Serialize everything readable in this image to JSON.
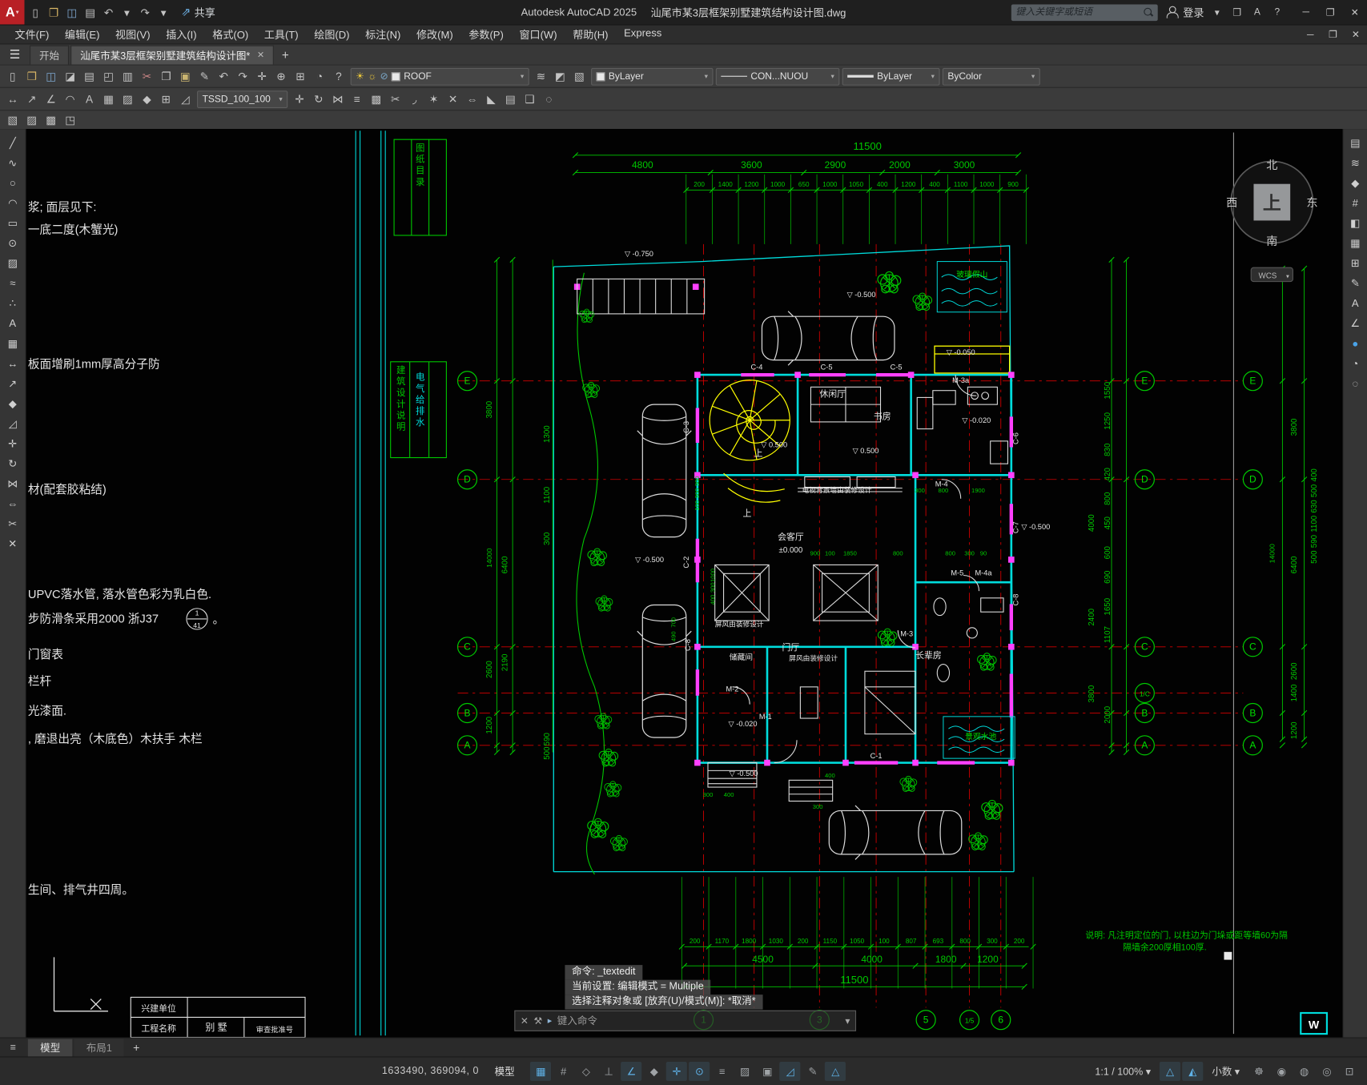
{
  "titlebar": {
    "logo_letter": "A",
    "quick_access": [
      {
        "name": "new-drawing-icon",
        "glyph": "▯"
      },
      {
        "name": "open-icon",
        "glyph": "❒",
        "color": "#d8b565"
      },
      {
        "name": "save-icon",
        "glyph": "◫",
        "color": "#7fa8d0"
      },
      {
        "name": "plot-icon",
        "glyph": "▤"
      },
      {
        "name": "undo-icon",
        "glyph": "↶"
      },
      {
        "name": "undo-caret-icon",
        "glyph": "▾"
      },
      {
        "name": "redo-icon",
        "glyph": "↷"
      },
      {
        "name": "redo-caret-icon",
        "glyph": "▾"
      }
    ],
    "share_label": "共享",
    "app_title": "Autodesk AutoCAD 2025",
    "doc_title": "汕尾市某3层框架别墅建筑结构设计图.dwg",
    "search_placeholder": "键入关键字或短语",
    "signin_label": "登录",
    "account_caret": "▾",
    "store_glyph": "❒",
    "assistant_glyph": "A",
    "help_glyph": "?"
  },
  "window_controls": {
    "minimize": "─",
    "restore": "❐",
    "close": "✕"
  },
  "menubar": {
    "items": [
      "文件(F)",
      "编辑(E)",
      "视图(V)",
      "插入(I)",
      "格式(O)",
      "工具(T)",
      "绘图(D)",
      "标注(N)",
      "修改(M)",
      "参数(P)",
      "窗口(W)",
      "帮助(H)",
      "Express"
    ]
  },
  "doc_tabs": {
    "start_tab": "开始",
    "drawing_tab": "汕尾市某3层框架别墅建筑结构设计图*",
    "close_glyph": "✕",
    "new_tab_button": "+",
    "hamburger_glyph": "☰"
  },
  "toolbar1": {
    "left_icons": [
      {
        "name": "qnew-icon",
        "glyph": "▯"
      },
      {
        "name": "open-icon",
        "glyph": "❒",
        "color": "#d8b565"
      },
      {
        "name": "save-icon",
        "glyph": "◫",
        "color": "#7fa8d0"
      },
      {
        "name": "save-as-icon",
        "glyph": "◪"
      },
      {
        "name": "plot-icon",
        "glyph": "▤"
      },
      {
        "name": "plot-preview-icon",
        "glyph": "◰"
      },
      {
        "name": "publish-icon",
        "glyph": "▥"
      },
      {
        "name": "cut-icon",
        "glyph": "✂",
        "color": "#c98585"
      },
      {
        "name": "copy-icon",
        "glyph": "❐"
      },
      {
        "name": "paste-icon",
        "glyph": "▣",
        "color": "#c9b470"
      },
      {
        "name": "match-properties-icon",
        "glyph": "✎"
      },
      {
        "name": "undo-icon",
        "glyph": "↶"
      },
      {
        "name": "redo-icon",
        "glyph": "↷"
      },
      {
        "name": "pan-icon",
        "glyph": "✛"
      },
      {
        "name": "zoom-realtime-icon",
        "glyph": "⊕"
      },
      {
        "name": "zoom-window-icon",
        "glyph": "⊞"
      },
      {
        "name": "orbit-icon",
        "glyph": "◔"
      },
      {
        "name": "help-icon",
        "glyph": "?"
      }
    ],
    "layer_combo": {
      "value": "ROOF",
      "on_glyph": "☀",
      "freeze_glyph": "☼",
      "lock_glyph": "⊘"
    },
    "mid_icons": [
      {
        "name": "layer-states-icon",
        "glyph": "≋"
      },
      {
        "name": "layer-isolate-icon",
        "glyph": "◩"
      },
      {
        "name": "layer-walk-icon",
        "glyph": "▧"
      }
    ],
    "color_combo": {
      "value": "ByLayer"
    },
    "linetype_combo": {
      "value": "CON...NUOU"
    },
    "lineweight_combo": {
      "value": "ByLayer"
    },
    "plotstyle_combo": {
      "value": "ByColor"
    }
  },
  "toolbar2": {
    "left_icons": [
      {
        "name": "dim-linear-icon",
        "glyph": "↔"
      },
      {
        "name": "dim-aligned-icon",
        "glyph": "↗"
      },
      {
        "name": "dim-angular-icon",
        "glyph": "∠"
      },
      {
        "name": "dim-radius-icon",
        "glyph": "◠"
      },
      {
        "name": "mtext-icon",
        "glyph": "A"
      },
      {
        "name": "table-icon",
        "glyph": "▦"
      },
      {
        "name": "hatch-icon",
        "glyph": "▨"
      },
      {
        "name": "block-icon",
        "glyph": "◆"
      },
      {
        "name": "insert-icon",
        "glyph": "⊞"
      },
      {
        "name": "measure-icon",
        "glyph": "◿"
      }
    ],
    "style_combo": {
      "value": "TSSD_100_100"
    },
    "right_icons": [
      {
        "name": "move-icon",
        "glyph": "✛"
      },
      {
        "name": "rotate-icon",
        "glyph": "↻"
      },
      {
        "name": "mirror-icon",
        "glyph": "⋈"
      },
      {
        "name": "offset-icon",
        "glyph": "≡"
      },
      {
        "name": "array-icon",
        "glyph": "▩"
      },
      {
        "name": "trim-icon",
        "glyph": "✂"
      },
      {
        "name": "fillet-icon",
        "glyph": "◞"
      },
      {
        "name": "explode-icon",
        "glyph": "✶"
      },
      {
        "name": "erase-icon",
        "glyph": "✕"
      },
      {
        "name": "stretch-icon",
        "glyph": "⇔"
      },
      {
        "name": "scale-icon",
        "glyph": "◣"
      },
      {
        "name": "properties-icon",
        "glyph": "▤"
      },
      {
        "name": "group-icon",
        "glyph": "❑"
      },
      {
        "name": "selection-icon",
        "glyph": "◌"
      }
    ]
  },
  "toolbar3": {
    "icons": [
      {
        "name": "edit-reference-icon",
        "glyph": "▧"
      },
      {
        "name": "image-attach-icon",
        "glyph": "▨"
      },
      {
        "name": "clip-xref-icon",
        "glyph": "▩"
      },
      {
        "name": "frame-icon",
        "glyph": "◳"
      }
    ]
  },
  "left_toolbar": {
    "icons": [
      {
        "name": "line-tool-icon",
        "glyph": "╱"
      },
      {
        "name": "polyline-tool-icon",
        "glyph": "∿"
      },
      {
        "name": "circle-tool-icon",
        "glyph": "○"
      },
      {
        "name": "arc-tool-icon",
        "glyph": "◠"
      },
      {
        "name": "rectangle-tool-icon",
        "glyph": "▭"
      },
      {
        "name": "ellipse-tool-icon",
        "glyph": "⊙"
      },
      {
        "name": "hatch-tool-icon",
        "glyph": "▨"
      },
      {
        "name": "spline-tool-icon",
        "glyph": "≈"
      },
      {
        "name": "point-tool-icon",
        "glyph": "∴"
      },
      {
        "name": "text-tool-icon",
        "glyph": "A"
      },
      {
        "name": "table-tool-icon",
        "glyph": "▦"
      },
      {
        "name": "dimension-tool-icon",
        "glyph": "↔"
      },
      {
        "name": "leader-tool-icon",
        "glyph": "↗"
      },
      {
        "name": "block-tool-icon",
        "glyph": "◆"
      },
      {
        "name": "measure-tool-icon",
        "glyph": "◿"
      },
      {
        "name": "move-tool-icon",
        "glyph": "✛"
      },
      {
        "name": "rotate-tool-icon",
        "glyph": "↻"
      },
      {
        "name": "mirror-tool-icon",
        "glyph": "⋈"
      },
      {
        "name": "stretch-tool-icon",
        "glyph": "⇔"
      },
      {
        "name": "trim-tool-icon",
        "glyph": "✂"
      },
      {
        "name": "erase-tool-icon",
        "glyph": "✕"
      }
    ]
  },
  "right_toolbar": {
    "icons": [
      {
        "name": "properties-panel-icon",
        "glyph": "▤"
      },
      {
        "name": "layers-panel-icon",
        "glyph": "≋"
      },
      {
        "name": "blocks-panel-icon",
        "glyph": "◆"
      },
      {
        "name": "count-panel-icon",
        "glyph": "#"
      },
      {
        "name": "views-panel-icon",
        "glyph": "◧"
      },
      {
        "name": "sheet-set-panel-icon",
        "glyph": "▦"
      },
      {
        "name": "xref-panel-icon",
        "glyph": "⊞"
      },
      {
        "name": "markup-panel-icon",
        "glyph": "✎"
      },
      {
        "name": "text-panel-icon",
        "glyph": "A"
      },
      {
        "name": "measure-panel-icon",
        "glyph": "∠"
      },
      {
        "name": "render-panel-icon",
        "glyph": "●",
        "color": "#4aa3e8"
      },
      {
        "name": "visual-style-icon",
        "glyph": "◔"
      },
      {
        "name": "cursor-badge-icon",
        "glyph": "◌"
      }
    ]
  },
  "compass": {
    "north": "北",
    "south": "南",
    "east": "东",
    "west": "西",
    "top": "上",
    "wcs": "WCS"
  },
  "drawing": {
    "top_dims": {
      "total": "11500",
      "segments": [
        "4800",
        "3600",
        "2900",
        "2000",
        "3000"
      ],
      "minor": [
        "200",
        "1400",
        "1200",
        "1000",
        "650",
        "1000",
        "1050",
        "400",
        "1200",
        "400",
        "1100",
        "1000",
        "900"
      ]
    },
    "bottom_dims": {
      "total": "11500",
      "segments": [
        "4500",
        "4000",
        "1800",
        "1200"
      ],
      "minor": [
        "200",
        "1170",
        "1800",
        "1030",
        "200",
        "1150",
        "1050",
        "100",
        "807",
        "693",
        "800",
        "300",
        "200"
      ]
    },
    "left_axes": [
      "E",
      "D",
      "C",
      "B",
      "A"
    ],
    "right_axes": [
      "E",
      "D",
      "C",
      "1/C",
      "B",
      "A"
    ],
    "far_right_axes": [
      "E",
      "D",
      "C",
      "B",
      "A"
    ],
    "bottom_axes": [
      "1",
      "3",
      "5",
      "1/5",
      "6"
    ],
    "left_dims_a": [
      "3800",
      "14000",
      "2600",
      "1200"
    ],
    "left_dims_b": [
      "6400",
      "2190"
    ],
    "left_dims_minor": [
      "1300",
      "1100",
      "300",
      "590",
      "500"
    ],
    "right_dims_a": [
      "1550",
      "1250",
      "830",
      "420",
      "800",
      "450",
      "600",
      "690",
      "1650",
      "1107",
      "2000"
    ],
    "right_dims_b": [
      "4000",
      "2400",
      "3800"
    ],
    "far_right_dims_a": [
      "3800",
      "6400",
      "2600",
      "1400",
      "1200"
    ],
    "far_right_dims_b": [
      "14000"
    ],
    "far_right_dims_minor": [
      "400",
      "500",
      "630",
      "1100",
      "590",
      "500"
    ],
    "interior_dims": [
      "300",
      "300",
      "100",
      "1000",
      "300",
      "400",
      "700",
      "490",
      "900",
      "100",
      "1850",
      "800",
      "800",
      "300",
      "90",
      "300",
      "800",
      "1900",
      "300",
      "400",
      "400",
      "300"
    ],
    "rooms": {
      "leisure": "休闲厅",
      "study": "书房",
      "living": "会客厅",
      "living_elev": "±0.000",
      "tv_note": "电视背景墙由装修设计",
      "screen_note": "屏风由装修设计",
      "screen_note2": "屏风由装修设计",
      "hall": "门厅",
      "storage": "储藏间",
      "elder": "长辈房",
      "rock": "玻璃假山",
      "pond": "景观水池",
      "up1": "上",
      "up2": "上"
    },
    "elevations": [
      "-0.750",
      "-0.500",
      "-0.050",
      "-0.020",
      "0.500",
      "0.500",
      "-0.500",
      "-0.020",
      "-0.500",
      "-0.500"
    ],
    "tags": [
      "C-4",
      "C-5",
      "C-5",
      "M-3a",
      "C-3",
      "C-6",
      "M-4",
      "C-2",
      "C-7",
      "M-5",
      "M-4a",
      "C-8",
      "M-3",
      "C-8",
      "M-2",
      "M-1",
      "C-1"
    ],
    "notes_left": [
      "浆; 面层见下:",
      "一底二度(木蟹光)",
      "板面增刷1mm厚高分子防",
      "材(配套胶粘结)",
      "UPVC落水管, 落水管色彩为乳白色.",
      "步防滑条采用2000 浙J37",
      "门窗表",
      "栏杆",
      "光漆面.",
      ", 磨退出亮（木底色）木扶手  木栏",
      "生间、排气井四周。"
    ],
    "detail_ref": {
      "top": "1",
      "bottom": "41",
      "suffix": "。"
    },
    "strip_labels": [
      "图纸目录",
      "建筑设计说明",
      "电气给排水"
    ],
    "note_right_1": "说明: 凡注明定位的门, 以柱边为门垛或距等墙60为隔",
    "note_right_2": "隔墙余200厚相100厚.",
    "title_block": {
      "row1": "兴建单位",
      "row2": "工程名称",
      "project": "别 墅",
      "approval": "审查批准号"
    },
    "corner_badge": "W"
  },
  "command": {
    "line1": "命令: _textedit",
    "line2": "当前设置: 编辑模式 = Multiple",
    "line3": "选择注释对象或 [放弃(U)/模式(M)]: *取消*",
    "input_placeholder": "键入命令",
    "close_glyph": "✕",
    "customize_glyph": "⚒",
    "history_glyph": "▾"
  },
  "layout_tabs": {
    "menu_glyph": "≡",
    "model": "模型",
    "layout1": "布局1",
    "add": "+"
  },
  "statusbar": {
    "coords": "1633490, 369094, 0",
    "model_label": "模型",
    "mid_icons": [
      {
        "name": "grid-icon",
        "glyph": "▦",
        "active": true
      },
      {
        "name": "snap-icon",
        "glyph": "#"
      },
      {
        "name": "infer-constraints-icon",
        "glyph": "◇"
      },
      {
        "name": "ortho-icon",
        "glyph": "⊥"
      },
      {
        "name": "polar-tracking-icon",
        "glyph": "∠",
        "active": true
      },
      {
        "name": "isometric-draft-icon",
        "glyph": "◆"
      },
      {
        "name": "object-snap-tracking-icon",
        "glyph": "✛",
        "active": true
      },
      {
        "name": "object-snap-icon",
        "glyph": "⊙",
        "active": true
      },
      {
        "name": "lineweight-display-icon",
        "glyph": "≡"
      },
      {
        "name": "transparency-icon",
        "glyph": "▨"
      },
      {
        "name": "selection-cycling-icon",
        "glyph": "▣"
      },
      {
        "name": "dynamic-ucs-icon",
        "glyph": "◿",
        "active": true
      },
      {
        "name": "dynamic-input-icon",
        "glyph": "✎"
      },
      {
        "name": "annotation-objects-icon",
        "glyph": "△",
        "active": true
      }
    ],
    "scale_label": "1:1 / 100% ▾",
    "r1_icons": [
      {
        "name": "annotation-autoscale-icon",
        "glyph": "△",
        "active": true
      },
      {
        "name": "annotation-visibility-icon",
        "glyph": "◭",
        "active": true
      }
    ],
    "units_label": "小数 ▾",
    "r2_icons": [
      {
        "name": "workspace-gear-icon",
        "glyph": "☸"
      },
      {
        "name": "annotation-monitor-icon",
        "glyph": "◉"
      },
      {
        "name": "graphics-performance-icon",
        "glyph": "◍"
      },
      {
        "name": "isolate-objects-icon",
        "glyph": "◎"
      },
      {
        "name": "clean-screen-icon",
        "glyph": "⊡"
      }
    ]
  }
}
